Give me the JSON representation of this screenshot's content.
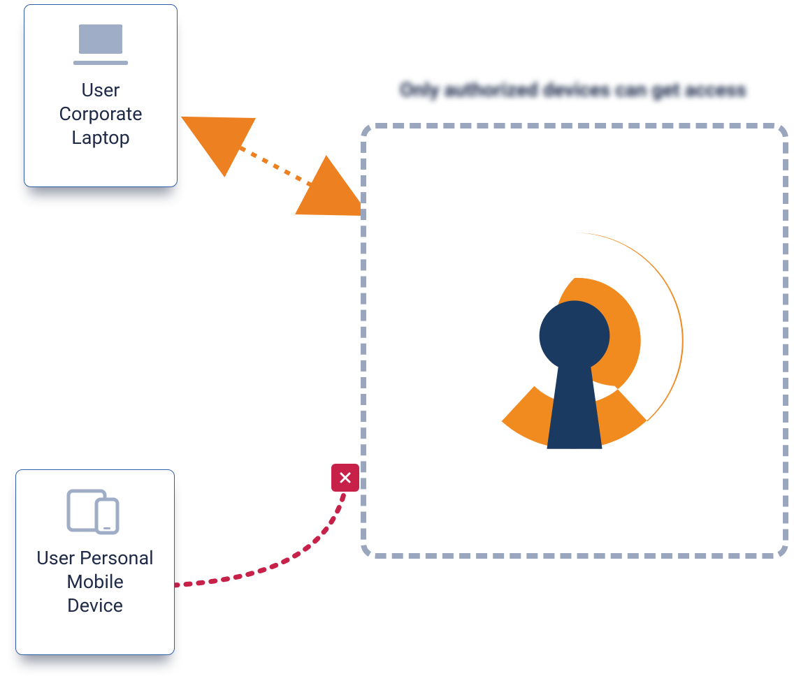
{
  "title": "Only authorized devices can get access",
  "nodes": {
    "corporate_laptop": {
      "label": "User\nCorporate\nLaptop"
    },
    "personal_mobile": {
      "label": "User Personal\nMobile\nDevice"
    }
  },
  "colors": {
    "node_border": "#2e5ea8",
    "node_text": "#1e2a47",
    "dash_border": "#9aa6bd",
    "allowed_connector": "#ed8122",
    "blocked_connector": "#c7214a",
    "blocked_badge_bg": "#c7214a",
    "title_text": "#1b2a4a",
    "openvpn_orange": "#f18a1f",
    "openvpn_navy": "#1b3a62",
    "icon_fill": "#9fadc6"
  },
  "connections": [
    {
      "from": "corporate_laptop",
      "to": "vpn_box",
      "status": "allowed",
      "style": "dashed-double-arrow"
    },
    {
      "from": "personal_mobile",
      "to": "vpn_box",
      "status": "blocked",
      "style": "dashed-curve"
    }
  ]
}
